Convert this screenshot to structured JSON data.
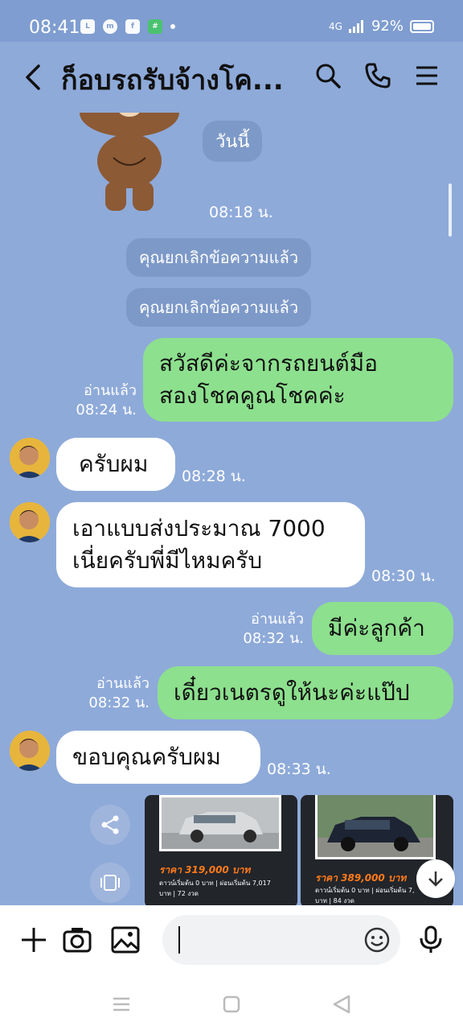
{
  "status_bar": {
    "time": "08:41",
    "notification_icons": [
      "line-icon",
      "messenger-icon",
      "facebook-icon",
      "app-icon"
    ],
    "network": "4G",
    "battery": "92%"
  },
  "header": {
    "title": "ก็อบรถรับจ้างโค...",
    "icons": [
      "back-icon",
      "search-icon",
      "phone-icon",
      "menu-icon"
    ]
  },
  "messages": {
    "date_divider": "วันนี้",
    "sticker_time": "08:18 น.",
    "system_1": "คุณยกเลิกข้อความแล้ว",
    "system_2": "คุณยกเลิกข้อความแล้ว",
    "m1": {
      "line1": "สวัสดีค่ะจากรถยนต์มือ",
      "line2": "สองโชคคูณโชคค่ะ",
      "read": "อ่านแล้ว",
      "time": "08:24 น."
    },
    "m2": {
      "text": "ครับผม",
      "time": "08:28 น."
    },
    "m3": {
      "line1": "เอาแบบส่งประมาณ 7000",
      "line2": "เนี่ยครับพี่มีไหมครับ",
      "time": "08:30 น."
    },
    "m4": {
      "text": "มีค่ะลูกค้า",
      "read": "อ่านแล้ว",
      "time": "08:32 น."
    },
    "m5": {
      "text": "เดี๋ยวเนตรดูให้นะค่ะแป๊ป",
      "read": "อ่านแล้ว",
      "time": "08:32 น."
    },
    "m6": {
      "text": "ขอบคุณครับผม",
      "time": "08:33 น."
    }
  },
  "cards": [
    {
      "price": "ราคา 319,000 บาท",
      "detail_1": "ดาวน์เริ่มต้น 0 บาท | ผ่อนเริ่มต้น 7,017",
      "detail_2": "บาท | 72 งวด"
    },
    {
      "price": "ราคา 389,000 บาท",
      "detail_1": "ดาวน์เริ่มต้น 0 บาท | ผ่อนเริ่มต้น 7,",
      "detail_2": "บาท | 84 งวด"
    }
  ],
  "composer": {
    "placeholder": ""
  },
  "colors": {
    "chat_bg": "#8eaad9",
    "outgoing": "#8de08e",
    "incoming": "#ffffff",
    "system_pill": "#7d99c8",
    "price": "#ff7a1a"
  }
}
